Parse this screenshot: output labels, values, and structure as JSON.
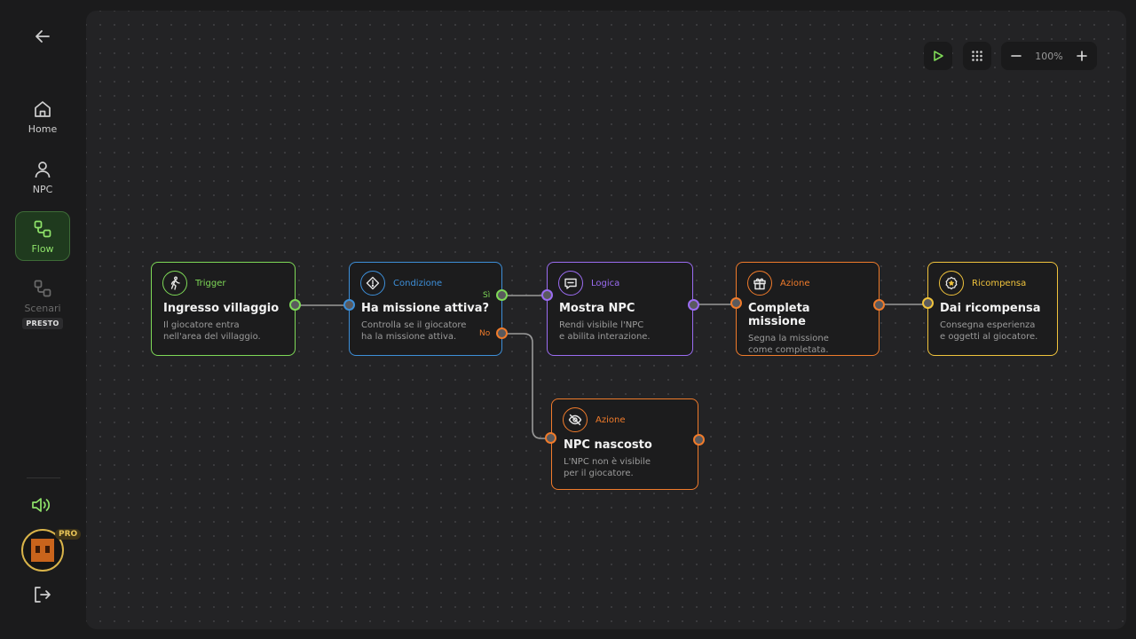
{
  "sidebar": {
    "items": [
      {
        "label": "Home"
      },
      {
        "label": "NPC"
      },
      {
        "label": "Flow"
      },
      {
        "label": "Scenari",
        "badge": "PRESTO"
      }
    ],
    "pro_badge": "PRO"
  },
  "toolbar": {
    "zoom": "100%"
  },
  "colors": {
    "trigger": "#7ed957",
    "condition": "#3d8fd9",
    "logic": "#9b6cf2",
    "action": "#f07b2b",
    "reward": "#f0c33c"
  },
  "nodes": {
    "trigger": {
      "type": "Trigger",
      "title": "Ingresso villaggio",
      "desc1": "Il giocatore entra",
      "desc2": "nell'area del villaggio.",
      "icon": "walking-person-icon"
    },
    "condition": {
      "type": "Condizione",
      "title": "Ha missione attiva?",
      "desc1": "Controlla se il giocatore",
      "desc2": "ha la missione attiva.",
      "icon": "diamond-check-icon",
      "yes": "Sì",
      "no": "No"
    },
    "logic": {
      "type": "Logica",
      "title": "Mostra NPC",
      "desc1": "Rendi visibile l'NPC",
      "desc2": "e abilita interazione.",
      "icon": "chat-bubble-icon"
    },
    "action_complete": {
      "type": "Azione",
      "title": "Completa missione",
      "desc1": "Segna la missione",
      "desc2": "come completata.",
      "icon": "gift-icon"
    },
    "reward": {
      "type": "Ricompensa",
      "title": "Dai ricompensa",
      "desc1": "Consegna esperienza",
      "desc2": "e oggetti al giocatore.",
      "icon": "star-badge-icon"
    },
    "action_hide": {
      "type": "Azione",
      "title": "NPC nascosto",
      "desc1": "L'NPC non è visibile",
      "desc2": "per il giocatore.",
      "icon": "eye-off-icon"
    }
  }
}
